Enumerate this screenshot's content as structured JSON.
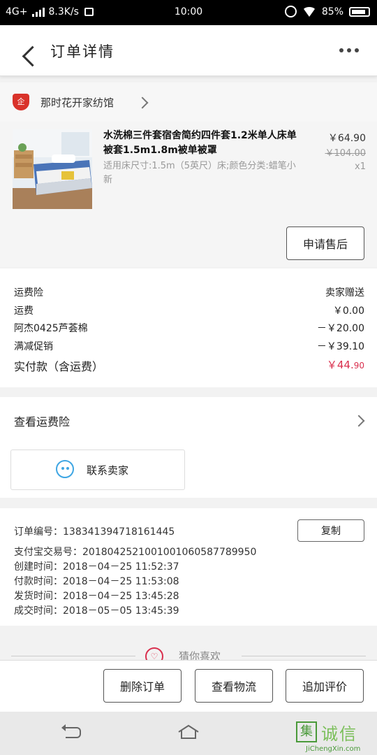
{
  "status_bar": {
    "network": "4G+",
    "speed": "8.3K/s",
    "time": "10:00",
    "battery": "85%",
    "battery_level": 0.85
  },
  "header": {
    "title": "订单详情"
  },
  "shop": {
    "name": "那时花开家纺馆",
    "logo_text": "企"
  },
  "product": {
    "title": "水洗棉三件套宿舍简约四件套1.2米单人床单被套1.5m1.8m被单被罩",
    "spec": "适用床尺寸:1.5m（5英尺）床;颜色分类:蜡笔小新",
    "price": "￥64.90",
    "original_price": "￥104.00",
    "quantity": "x1",
    "after_sale_label": "申请售后"
  },
  "fees": [
    {
      "label": "运费险",
      "value": "卖家赠送"
    },
    {
      "label": "运费",
      "value": "￥0.00"
    },
    {
      "label": "阿杰0425芦荟棉",
      "value": "－￥20.00"
    },
    {
      "label": "满减促销",
      "value": "－￥39.10"
    }
  ],
  "total": {
    "label": "实付款（含运费）",
    "value_main": "￥44.",
    "value_cents": "90"
  },
  "insurance": {
    "label": "查看运费险"
  },
  "contact": {
    "label": "联系卖家"
  },
  "order_info": {
    "order_no": "订单编号：138341394718161445",
    "alipay_no": "支付宝交易号：2018042521001001060587789950",
    "created": "创建时间：2018－04－25 11:52:37",
    "paid": "付款时间：2018－04－25 11:53:08",
    "shipped": "发货时间：2018－04－25 13:45:28",
    "completed": "成交时间：2018－05－05 13:45:39",
    "copy_label": "复制"
  },
  "guess": {
    "label": "猜你喜欢"
  },
  "actions": {
    "delete": "删除订单",
    "logistics": "查看物流",
    "review": "追加评价"
  },
  "watermark": {
    "cn": "诚信",
    "en": "JiChengXin.com",
    "logo": "集"
  },
  "colors": {
    "accent_red": "#d9304e",
    "contact_blue": "#3fa6e3"
  }
}
